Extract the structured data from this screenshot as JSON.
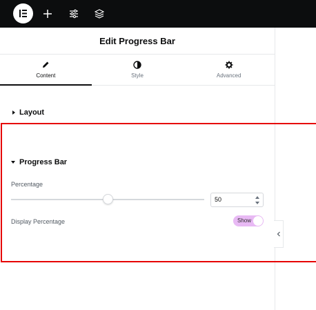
{
  "topbar": {
    "logo_icon": "elementor-logo-icon",
    "buttons": [
      {
        "icon": "plus-icon"
      },
      {
        "icon": "sliders-icon"
      },
      {
        "icon": "layers-icon"
      }
    ]
  },
  "panel": {
    "title": "Edit Progress Bar",
    "tabs": [
      {
        "label": "Content",
        "icon": "pencil-icon",
        "active": true
      },
      {
        "label": "Style",
        "icon": "half-circle-icon",
        "active": false
      },
      {
        "label": "Advanced",
        "icon": "gear-icon",
        "active": false
      }
    ],
    "sections": {
      "layout": {
        "title": "Layout",
        "expanded": false
      },
      "progress_bar": {
        "title": "Progress Bar",
        "expanded": true,
        "percentage_label": "Percentage",
        "percentage_value": "50",
        "slider_fraction": 0.5,
        "display_percentage_label": "Display Percentage",
        "display_toggle_label": "Show",
        "display_toggle_on": true
      }
    }
  },
  "colors": {
    "topbar_bg": "#0c0d0e",
    "highlight_border": "#e60000",
    "toggle_bg": "#e8b9f4"
  }
}
